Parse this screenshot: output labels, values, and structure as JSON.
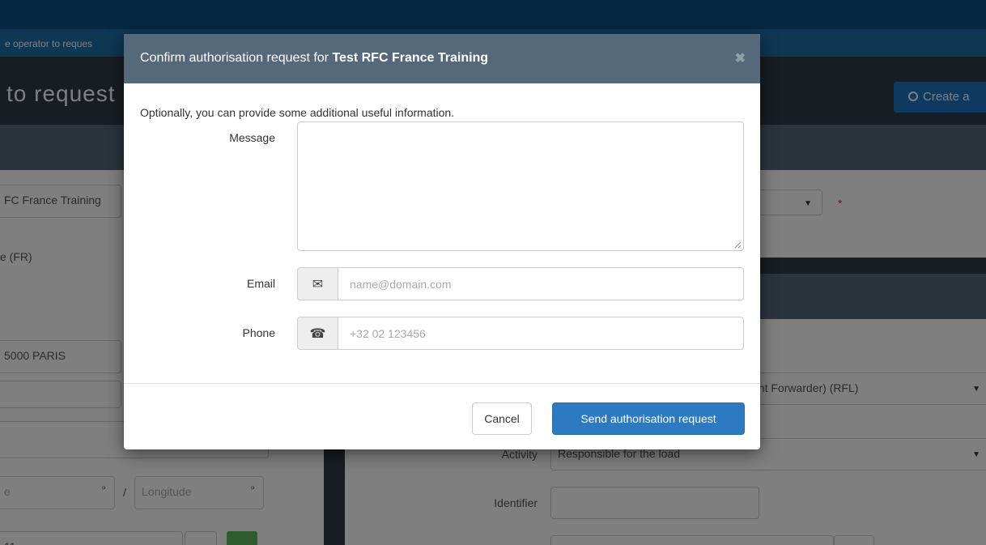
{
  "background": {
    "subbar_text": "e operator to reques",
    "header_title": "to request",
    "create_button_label": "Create a",
    "left_panel": {
      "company_value": "FC France Training",
      "country_text": "e (FR)",
      "city_value": "5000 PARIS",
      "latitude_placeholder": "e",
      "degree_symbol": "°",
      "coord_separator": "/",
      "longitude_placeholder": "Longitude",
      "bottom_partial": "11"
    },
    "right_panel": {
      "dropdown_caret": "▼",
      "required_star": "*",
      "role_value": "ght Forwarder) (RFL)",
      "activity_label": "Activity",
      "activity_value": "Responsible for the load",
      "identifier_label": "Identifier"
    }
  },
  "modal": {
    "title_prefix": "Confirm authorisation request for ",
    "title_company": "Test RFC France Training",
    "close_symbol": "✖",
    "intro_text": "Optionally, you can provide some additional useful information.",
    "message_label": "Message",
    "message_value": "",
    "email_label": "Email",
    "email_icon": "✉",
    "email_placeholder": "name@domain.com",
    "phone_label": "Phone",
    "phone_icon": "☎",
    "phone_placeholder": "+32 02 123456",
    "cancel_label": "Cancel",
    "send_label": "Send authorisation request"
  }
}
